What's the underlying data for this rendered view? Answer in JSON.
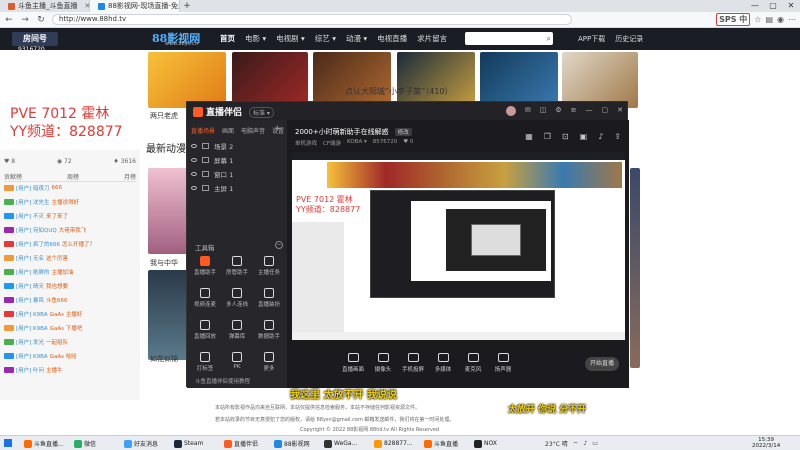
{
  "browser": {
    "tabs": [
      {
        "label": "斗鱼主播_斗鱼直播",
        "active": false
      },
      {
        "label": "88影视网-现场直播-免费电影-电...",
        "active": true
      }
    ],
    "url": "http://www.88hd.tv",
    "sogou_badge": "SPS 中"
  },
  "site": {
    "logo": "88影视网",
    "logo_sub": "www.88ys.cn",
    "nav": [
      "首页",
      "电影 ▾",
      "电视剧 ▾",
      "综艺 ▾",
      "动漫 ▾",
      "电视直播",
      "求片留言"
    ],
    "right_links": [
      "APP下载",
      "历史记录"
    ],
    "player_info": "点认大阳城“小李子第”（410）",
    "section_title": "最新动漫",
    "captions": [
      "两只老虎",
      "我与中华",
      "如花似锦"
    ]
  },
  "overlay": {
    "room_label": "房间号",
    "room_number": "9316720",
    "line1": "PVE 7012 霍林",
    "line2": "YY频道：828877",
    "stats": [
      "♥ 8",
      "◉ 72",
      "♦ 3616"
    ],
    "chat_tabs": [
      "贡献榜",
      "周榜",
      "月榜"
    ],
    "chat": [
      {
        "user": "[用户] 暗夜刀",
        "msg": "666"
      },
      {
        "user": "[用户] 沈先生",
        "msg": "主播说得好"
      },
      {
        "user": "[用户] 不灭",
        "msg": "来了来了"
      },
      {
        "user": "[用户] 宛如QUQ",
        "msg": "大佬带我飞"
      },
      {
        "user": "[用户] 疯了的666",
        "msg": "怎么开播了？"
      },
      {
        "user": "[用户] 无名",
        "msg": "这个厉害"
      },
      {
        "user": "[用户] 刷屏的",
        "msg": "主播加油"
      },
      {
        "user": "[用户] 晴天",
        "msg": "我也想要"
      },
      {
        "user": "[用户] 暴风",
        "msg": "斗鱼666"
      },
      {
        "user": "[用户] K9BA",
        "msg": "GaAs 主播好"
      },
      {
        "user": "[用户] K9BA",
        "msg": "GaAs 下播吧"
      },
      {
        "user": "[用户] 发光",
        "msg": "一起组队"
      },
      {
        "user": "[用户] K9BA",
        "msg": "GaAs 哈哈"
      },
      {
        "user": "[用户] 叶问",
        "msg": "主播牛"
      }
    ]
  },
  "app": {
    "title": "直播伴侣",
    "version": "标准 ▾",
    "scene_tabs": [
      "直播场景",
      "画面",
      "电脑声音",
      "设置"
    ],
    "scenes": [
      "场景 2",
      "屏幕 1",
      "窗口 1",
      "主屏 1"
    ],
    "toolbox_title": "工具箱",
    "tools": [
      {
        "label": "直播助手",
        "hot": true
      },
      {
        "label": "房管助手",
        "hot": false
      },
      {
        "label": "主播任务",
        "hot": false
      },
      {
        "label": "视频连麦",
        "hot": false
      },
      {
        "label": "多人连线",
        "hot": false
      },
      {
        "label": "直播装扮",
        "hot": false
      },
      {
        "label": "直播回放",
        "hot": false
      },
      {
        "label": "弹幕库",
        "hot": false
      },
      {
        "label": "数据助手",
        "hot": false
      },
      {
        "label": "打标签",
        "hot": false
      },
      {
        "label": "PK",
        "hot": false
      },
      {
        "label": "更多",
        "hot": false
      }
    ],
    "footer": "斗鱼直播伴侣使用教程",
    "stream_title": "2000+小时萌新助手在线解惑",
    "stream_tag": "修改",
    "stream_sub": [
      "单机游戏",
      "CF端游",
      "KOBA ▾",
      "8576720",
      "♥ 0"
    ],
    "preview_line1": "PVE 7012 霍林",
    "preview_line2": "YY频道：828877",
    "bottom_items": [
      "直播画面",
      "摄像头",
      "手机投屏",
      "多媒体",
      "麦克风",
      "扬声器"
    ],
    "go_live": "开始直播"
  },
  "subtitles": {
    "line1": "我这里 太放不开 我说说",
    "line2": "太放开 你说 分不开"
  },
  "footer_text": [
    "本站所有影视作品均来自互联网，本站仅提供信息检索服务，本站不存储任何影视资源文件。",
    "若本站收录的节目无意侵犯了您的版权，请给 88ysn@gmail.com 邮箱发送邮件，我们将在第一时间处理。",
    "Copyright © 2022 88影视网 88hd.tv All Rights Reserved"
  ],
  "taskbar": {
    "apps": [
      {
        "label": "斗鱼直播...",
        "color": "#ff6a00"
      },
      {
        "label": "微信",
        "color": "#2aae67"
      },
      {
        "label": "好友消息",
        "color": "#3aa1ff"
      },
      {
        "label": "Steam",
        "color": "#1b2838"
      },
      {
        "label": "直播伴侣",
        "color": "#ff5a1f"
      },
      {
        "label": "88影视网",
        "color": "#1e88e5"
      },
      {
        "label": "WeGa...",
        "color": "#333"
      },
      {
        "label": "828877...",
        "color": "#ff9800"
      },
      {
        "label": "斗鱼直播",
        "color": "#ff6a00"
      },
      {
        "label": "NOX",
        "color": "#222"
      }
    ],
    "weather": "23°C 晴",
    "time": "15:39",
    "date": "2022/3/14"
  }
}
